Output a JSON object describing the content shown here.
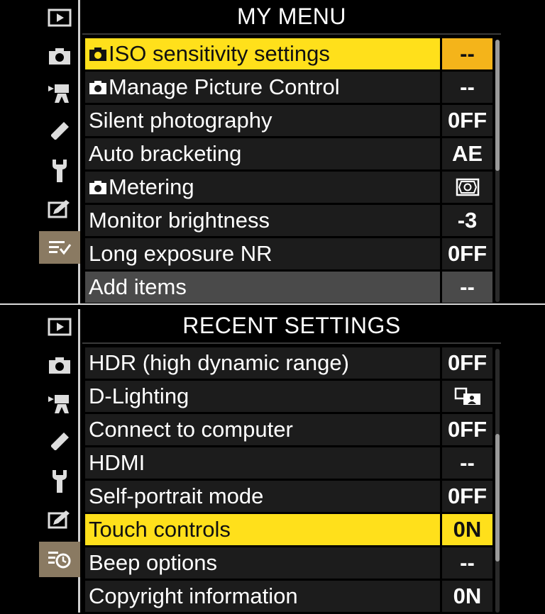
{
  "my_menu": {
    "title": "MY MENU",
    "sidebar_icons": [
      "playback-icon",
      "camera-icon",
      "movie-camera-icon",
      "pencil-icon",
      "wrench-icon",
      "retouch-icon",
      "my-menu-icon"
    ],
    "active_tab": "my-menu-icon",
    "rows": [
      {
        "label": "ISO sensitivity settings",
        "camera_prefix": true,
        "value": "--"
      },
      {
        "label": "Manage Picture Control",
        "camera_prefix": true,
        "value": "--"
      },
      {
        "label": "Silent photography",
        "camera_prefix": false,
        "value": "0FF"
      },
      {
        "label": "Auto bracketing",
        "camera_prefix": false,
        "value": "AE"
      },
      {
        "label": "Metering",
        "camera_prefix": true,
        "value_icon": "matrix-metering-icon"
      },
      {
        "label": "Monitor brightness",
        "camera_prefix": false,
        "value": "-3"
      },
      {
        "label": "Long exposure NR",
        "camera_prefix": false,
        "value": "0FF"
      },
      {
        "label": "Add items",
        "camera_prefix": false,
        "value": "--"
      }
    ],
    "selected_row": "ISO sensitivity settings"
  },
  "recent_settings": {
    "title": "RECENT SETTINGS",
    "sidebar_icons": [
      "playback-icon",
      "camera-icon",
      "movie-camera-icon",
      "pencil-icon",
      "wrench-icon",
      "retouch-icon",
      "recent-settings-icon"
    ],
    "active_tab": "recent-settings-icon",
    "rows": [
      {
        "label": "HDR (high dynamic range)",
        "value": "0FF"
      },
      {
        "label": "D-Lighting",
        "value_icon": "d-lighting-icon"
      },
      {
        "label": "Connect to computer",
        "value": "0FF"
      },
      {
        "label": "HDMI",
        "value": "--"
      },
      {
        "label": "Self-portrait mode",
        "value": "0FF"
      },
      {
        "label": "Touch controls",
        "value": "0N"
      },
      {
        "label": "Beep options",
        "value": "--"
      },
      {
        "label": "Copyright information",
        "value": "0N"
      }
    ],
    "selected_row": "Touch controls"
  },
  "colors": {
    "highlight_label": "#ffe01b",
    "highlight_value": "#f4b41a",
    "row_bg": "#1c1c1c",
    "active_tab_bg": "#8a7a62"
  }
}
